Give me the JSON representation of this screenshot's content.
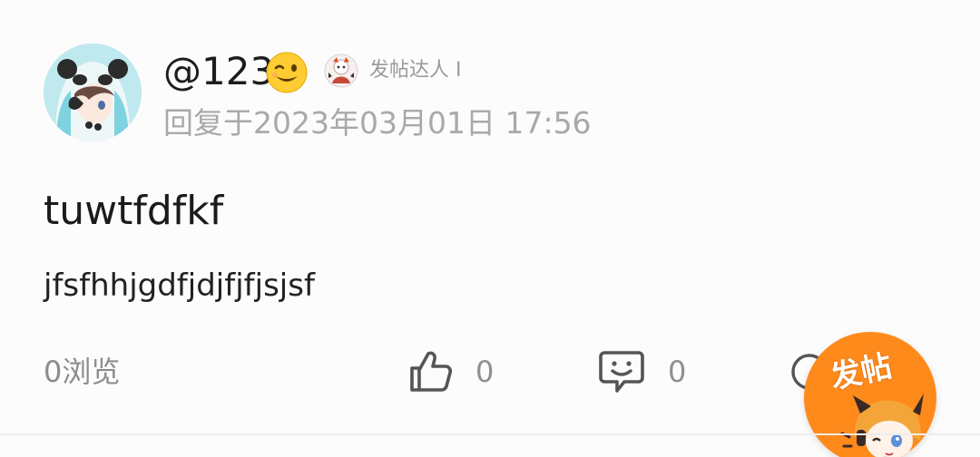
{
  "author": {
    "avatar_icon": "panda-hood-girl-avatar",
    "username": "@123",
    "emoji_icon": "winking-face-emoji",
    "badge_icon": "poster-badge-icon",
    "badge_label": "发帖达人 I",
    "reply_time": "回复于2023年03月01日 17:56"
  },
  "post": {
    "title": "tuwtfdfkf",
    "body": "jfsfhhjgdfjdjfjfjsjsf"
  },
  "stats": {
    "views_label": "0浏览",
    "likes_count": "0",
    "comments_count": "0"
  },
  "fab": {
    "label": "发帖",
    "color": "#ff8a1c"
  },
  "colors": {
    "text_primary": "#1b1b1b",
    "text_secondary": "#a9a9a9",
    "icon_gray": "#555555"
  }
}
